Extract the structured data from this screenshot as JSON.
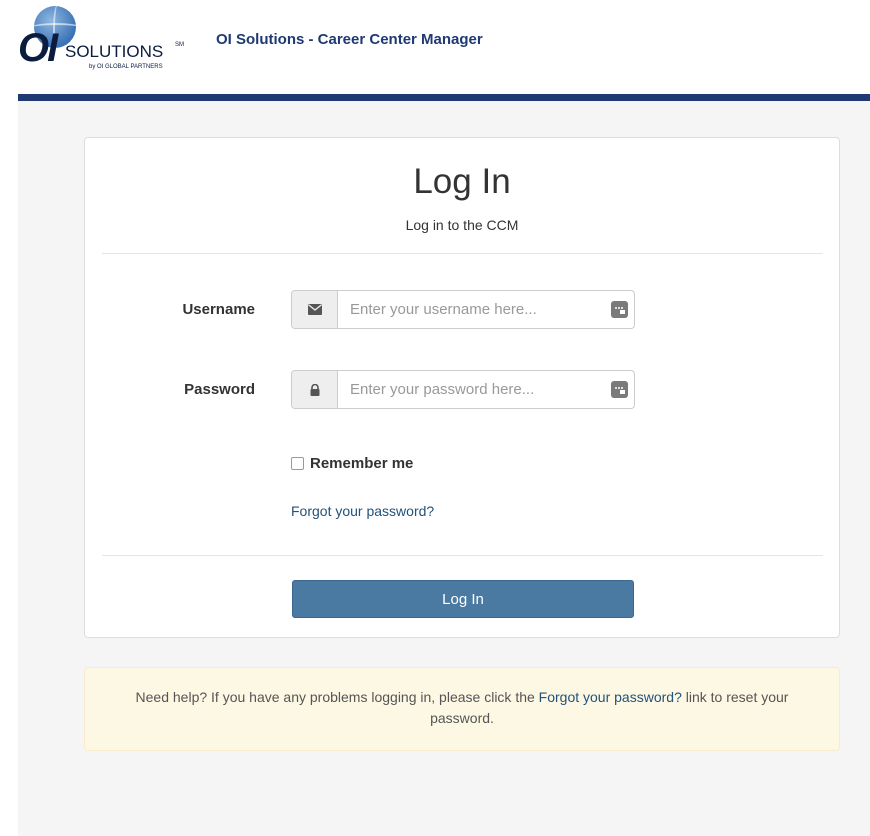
{
  "header": {
    "logo": {
      "mark": "OI",
      "name": "SOLUTIONS",
      "tm": "SM",
      "sub": "by OI GLOBAL PARTNERS"
    },
    "app_title": "OI Solutions - Career Center Manager",
    "bar_color": "#1f3a73"
  },
  "login_panel": {
    "title": "Log In",
    "subtitle": "Log in to the CCM",
    "username": {
      "label": "Username",
      "placeholder": "Enter your username here...",
      "value": "",
      "icon": "envelope-icon"
    },
    "password": {
      "label": "Password",
      "placeholder": "Enter your password here...",
      "value": "",
      "icon": "lock-icon"
    },
    "remember_me": {
      "label": "Remember me",
      "checked": false
    },
    "forgot_link": "Forgot your password?",
    "submit_label": "Log In",
    "button_color": "#4a7aa1"
  },
  "help": {
    "text_before": "Need help? If you have any problems logging in, please click the ",
    "link_text": "Forgot your password?",
    "text_after": " link to reset your password."
  }
}
